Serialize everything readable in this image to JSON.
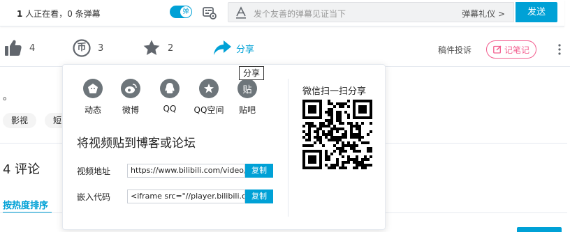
{
  "topbar": {
    "viewers_count": "1",
    "viewers_text": " 人正在看，",
    "danmaku_count": "0 条弹幕",
    "toggle_label": "弹",
    "input_placeholder": "发个友善的弹幕见证当下",
    "etiquette": "弹幕礼仪 >",
    "send": "发送"
  },
  "actions": {
    "like": "4",
    "coin": "3",
    "coin_glyph": "币",
    "favorite": "2",
    "share": "分享",
    "report": "稿件投诉",
    "note": "记笔记"
  },
  "content": {
    "dot": "。",
    "tags": [
      "影视",
      "短"
    ],
    "comments": "4  评论",
    "sort_tab": "按热度排序"
  },
  "share_popup": {
    "platforms": [
      {
        "label": "动态",
        "icon": "dynamic-icon"
      },
      {
        "label": "微博",
        "icon": "weibo-icon"
      },
      {
        "label": "QQ",
        "icon": "qq-icon"
      },
      {
        "label": "QQ空间",
        "icon": "qzone-icon"
      },
      {
        "label": "贴吧",
        "icon": "tieba-icon",
        "glyph": "贴"
      }
    ],
    "embed_title": "将视频贴到博客或论坛",
    "video_url_label": "视频地址",
    "video_url": "https://www.bilibili.com/video/",
    "embed_code_label": "嵌入代码",
    "embed_code": "<iframe src=\"//player.bilibili.co",
    "copy": "复制",
    "qr_title": "微信扫一扫分享"
  },
  "tooltip": "分享",
  "colors": {
    "accent": "#00a1d6",
    "note_pink": "#f25d8e",
    "icon_gray": "#6d757a"
  }
}
